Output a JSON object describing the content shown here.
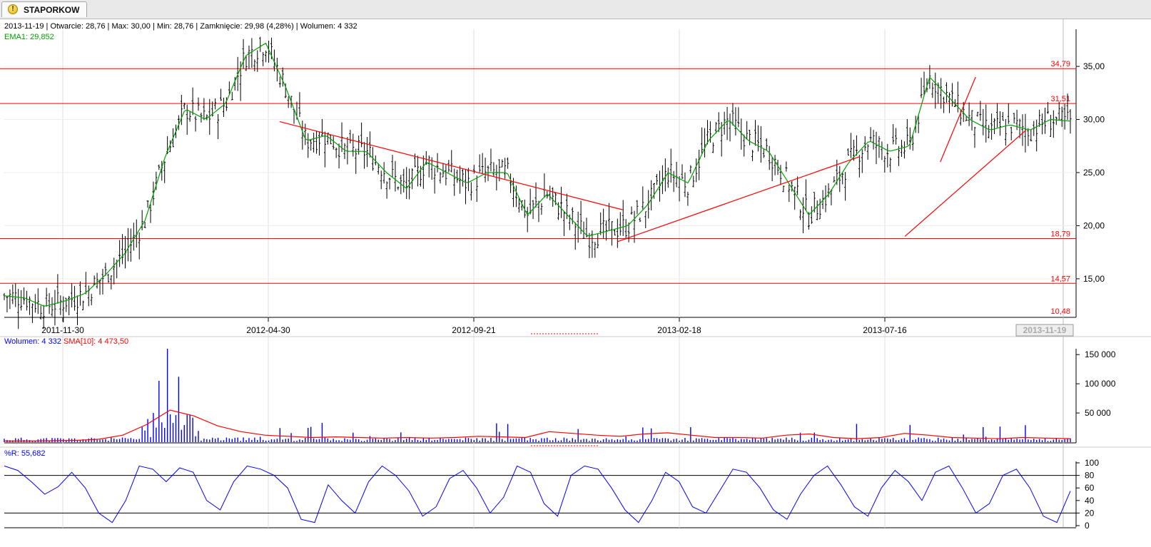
{
  "tab": {
    "label": "STAPORKOW",
    "icon": "warning-icon"
  },
  "header": {
    "date": "2013-11-19",
    "open_label": "Otwarcie:",
    "open": "28,76",
    "max_label": "Max:",
    "max": "30,00",
    "min_label": "Min:",
    "min": "28,76",
    "close_label": "Zamknięcie:",
    "close": "29,98",
    "change": "(4,28%)",
    "volume_label": "Wolumen:",
    "volume": "4 332"
  },
  "ema": {
    "label": "EMA1:",
    "value": "29,852",
    "color": "#00a000"
  },
  "volume_panel": {
    "label": "Wolumen:",
    "value": "4 332",
    "sma_label": "SMA[10]:",
    "sma_value": "4 473,50",
    "color": "#0000ff",
    "sma_color": "#ff0000"
  },
  "wr_panel": {
    "label": "%R:",
    "value": "55,682",
    "color": "#0000ff"
  },
  "cursor_date": "2013-11-19",
  "chart_data": [
    {
      "type": "candlestick",
      "x_dates": [
        "2011-11-30",
        "2012-04-30",
        "2012-09-21",
        "2013-02-18",
        "2013-07-16"
      ],
      "ylim": [
        11.5,
        38.5
      ],
      "y_ticks": [
        "15,00",
        "20,00",
        "25,00",
        "30,00",
        "35,00"
      ],
      "y_tick_values": [
        15,
        20,
        25,
        30,
        35
      ],
      "ema_series": [
        13.4,
        13.2,
        12.4,
        12.9,
        13.6,
        15.3,
        17.4,
        20.5,
        26.5,
        31.0,
        30.0,
        31.5,
        36.0,
        37.2,
        33.0,
        28.0,
        28.5,
        27.0,
        27.0,
        25.0,
        23.5,
        26.0,
        25.0,
        24.0,
        25.0,
        25.0,
        21.0,
        23.0,
        21.0,
        19.0,
        19.5,
        20.0,
        22.0,
        25.0,
        24.0,
        28.0,
        30.0,
        28.0,
        27.0,
        24.0,
        21.0,
        23.0,
        26.0,
        28.0,
        27.0,
        27.5,
        34.0,
        32.0,
        30.0,
        29.0,
        29.5,
        29.0,
        30.0,
        29.85
      ],
      "horizontal_levels": [
        "34,79",
        "31,51",
        "18,79",
        "14,57",
        "10,48"
      ],
      "horizontal_level_values": [
        34.79,
        31.51,
        18.79,
        14.57,
        10.48
      ],
      "trendlines": [
        {
          "from": [
            2012.34,
            29.8
          ],
          "to": [
            2013.02,
            21.5
          ]
        },
        {
          "from": [
            2013.01,
            18.5
          ],
          "to": [
            2013.49,
            26.5
          ]
        },
        {
          "from": [
            2013.58,
            19.0
          ],
          "to": [
            2013.82,
            29.0
          ]
        },
        {
          "from": [
            2013.65,
            26.0
          ],
          "to": [
            2013.72,
            34.0
          ]
        }
      ],
      "colors": {
        "candles": "#000000",
        "ema": "#00a000",
        "levels": "#ff0000",
        "level_labels": "#ff0000"
      }
    },
    {
      "type": "bar",
      "name": "Wolumen",
      "ylim": [
        0,
        160000
      ],
      "y_ticks": [
        "50 000",
        "100 000",
        "150 000"
      ],
      "y_tick_values": [
        50000,
        100000,
        150000
      ],
      "sma_name": "SMA[10]",
      "sma_series": [
        2000,
        2000,
        2500,
        3000,
        5000,
        12000,
        30000,
        55000,
        45000,
        28000,
        18000,
        12000,
        10000,
        8000,
        9000,
        8000,
        7000,
        8000,
        7000,
        8000,
        10000,
        9000,
        8000,
        18000,
        15000,
        12000,
        10000,
        14000,
        16000,
        12000,
        8000,
        8000,
        7000,
        12000,
        14000,
        8000,
        6000,
        8000,
        15000,
        12000,
        8000,
        7000,
        6000,
        8000,
        7000,
        6000
      ],
      "colors": {
        "bars": "#0000ff",
        "sma": "#ff0000"
      }
    },
    {
      "type": "line",
      "name": "%R",
      "ylim": [
        0,
        100
      ],
      "y_ticks": [
        "0",
        "20",
        "40",
        "60",
        "80",
        "100"
      ],
      "y_tick_values": [
        0,
        20,
        40,
        60,
        80,
        100
      ],
      "levels": [
        20,
        80
      ],
      "series_values": [
        95,
        88,
        70,
        50,
        62,
        85,
        60,
        20,
        5,
        40,
        95,
        90,
        70,
        92,
        85,
        40,
        25,
        70,
        95,
        90,
        80,
        60,
        10,
        5,
        65,
        40,
        20,
        70,
        95,
        80,
        55,
        15,
        30,
        75,
        88,
        60,
        20,
        45,
        95,
        85,
        35,
        15,
        80,
        95,
        90,
        60,
        25,
        5,
        40,
        85,
        70,
        30,
        20,
        55,
        90,
        85,
        60,
        25,
        10,
        50,
        80,
        95,
        65,
        30,
        15,
        60,
        88,
        70,
        40,
        85,
        95,
        60,
        20,
        35,
        80,
        90,
        60,
        15,
        5,
        55
      ],
      "colors": {
        "line": "#0000ff",
        "levels": "#000000"
      }
    }
  ]
}
